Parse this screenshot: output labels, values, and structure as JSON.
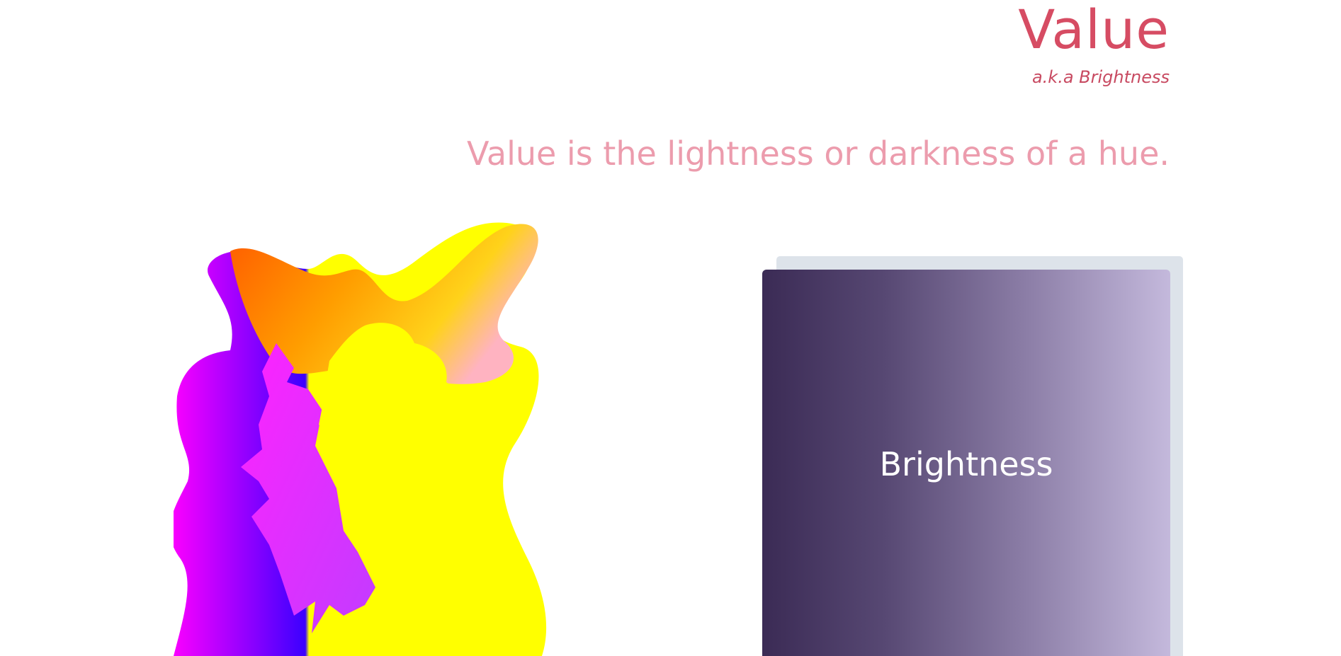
{
  "header": {
    "title": "Value",
    "subtitle": "a.k.a Brightness"
  },
  "main": {
    "tagline": "Value is the lightness or darkness of a hue."
  },
  "card": {
    "label": "Brightness",
    "gradient_colors": [
      "#3b2b55",
      "#574873",
      "#8c7ea7",
      "#c4b9dc"
    ]
  },
  "colors": {
    "title": "#d64c63",
    "tagline": "#ec9cad",
    "card_shadow": "#dde3ea"
  },
  "illustration": {
    "icon": "abstract-paint-splash-icon"
  }
}
